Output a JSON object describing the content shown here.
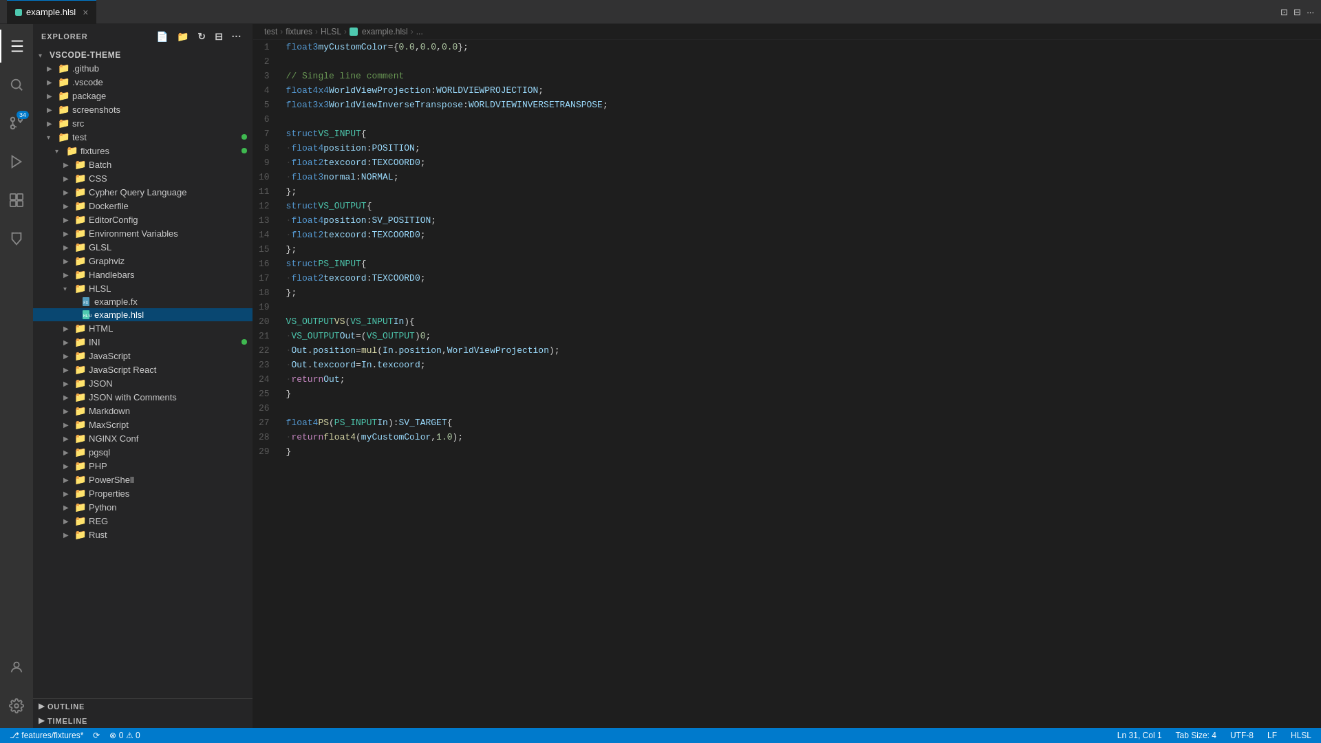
{
  "titlebar": {
    "tab_label": "example.hlsl",
    "tab_icon_color": "#9cdcfe"
  },
  "breadcrumb": {
    "parts": [
      "test",
      "fixtures",
      "HLSL",
      "example.hlsl",
      "..."
    ]
  },
  "explorer": {
    "title": "EXPLORER",
    "root": "VSCODE-THEME",
    "items": [
      {
        "id": "github",
        "label": ".github",
        "type": "folder",
        "indent": 1,
        "collapsed": true
      },
      {
        "id": "vscode",
        "label": ".vscode",
        "type": "folder",
        "indent": 1,
        "collapsed": true
      },
      {
        "id": "package",
        "label": "package",
        "type": "folder",
        "indent": 1,
        "collapsed": true
      },
      {
        "id": "screenshots",
        "label": "screenshots",
        "type": "folder",
        "indent": 1,
        "collapsed": true
      },
      {
        "id": "src",
        "label": "src",
        "type": "folder",
        "indent": 1,
        "collapsed": true
      },
      {
        "id": "test",
        "label": "test",
        "type": "folder",
        "indent": 1,
        "collapsed": false,
        "badge": true
      },
      {
        "id": "fixtures",
        "label": "fixtures",
        "type": "folder",
        "indent": 2,
        "collapsed": false,
        "badge": true
      },
      {
        "id": "batch",
        "label": "Batch",
        "type": "folder",
        "indent": 3,
        "collapsed": true
      },
      {
        "id": "css",
        "label": "CSS",
        "type": "folder",
        "indent": 3,
        "collapsed": true
      },
      {
        "id": "cypher",
        "label": "Cypher Query Language",
        "type": "folder",
        "indent": 3,
        "collapsed": true
      },
      {
        "id": "dockerfile",
        "label": "Dockerfile",
        "type": "folder",
        "indent": 3,
        "collapsed": true
      },
      {
        "id": "editorconfig",
        "label": "EditorConfig",
        "type": "folder",
        "indent": 3,
        "collapsed": true
      },
      {
        "id": "envvars",
        "label": "Environment Variables",
        "type": "folder",
        "indent": 3,
        "collapsed": true
      },
      {
        "id": "glsl",
        "label": "GLSL",
        "type": "folder",
        "indent": 3,
        "collapsed": true
      },
      {
        "id": "graphviz",
        "label": "Graphviz",
        "type": "folder",
        "indent": 3,
        "collapsed": true
      },
      {
        "id": "handlebars",
        "label": "Handlebars",
        "type": "folder",
        "indent": 3,
        "collapsed": true
      },
      {
        "id": "hlsl",
        "label": "HLSL",
        "type": "folder",
        "indent": 3,
        "collapsed": false
      },
      {
        "id": "example-fx",
        "label": "example.fx",
        "type": "file",
        "indent": 4,
        "ext": "fx"
      },
      {
        "id": "example-hlsl",
        "label": "example.hlsl",
        "type": "file",
        "indent": 4,
        "ext": "hlsl",
        "selected": true
      },
      {
        "id": "html",
        "label": "HTML",
        "type": "folder",
        "indent": 3,
        "collapsed": true
      },
      {
        "id": "ini",
        "label": "INI",
        "type": "folder",
        "indent": 3,
        "collapsed": true,
        "badge": true
      },
      {
        "id": "javascript",
        "label": "JavaScript",
        "type": "folder",
        "indent": 3,
        "collapsed": true
      },
      {
        "id": "javascriptreact",
        "label": "JavaScript React",
        "type": "folder",
        "indent": 3,
        "collapsed": true
      },
      {
        "id": "json",
        "label": "JSON",
        "type": "folder",
        "indent": 3,
        "collapsed": true
      },
      {
        "id": "jsoncomments",
        "label": "JSON with Comments",
        "type": "folder",
        "indent": 3,
        "collapsed": true
      },
      {
        "id": "markdown",
        "label": "Markdown",
        "type": "folder",
        "indent": 3,
        "collapsed": true
      },
      {
        "id": "maxscript",
        "label": "MaxScript",
        "type": "folder",
        "indent": 3,
        "collapsed": true
      },
      {
        "id": "nginx",
        "label": "NGINX Conf",
        "type": "folder",
        "indent": 3,
        "collapsed": true
      },
      {
        "id": "pgsql",
        "label": "pgsql",
        "type": "folder",
        "indent": 3,
        "collapsed": true
      },
      {
        "id": "php",
        "label": "PHP",
        "type": "folder",
        "indent": 3,
        "collapsed": true
      },
      {
        "id": "powershell",
        "label": "PowerShell",
        "type": "folder",
        "indent": 3,
        "collapsed": true
      },
      {
        "id": "properties",
        "label": "Properties",
        "type": "folder",
        "indent": 3,
        "collapsed": true
      },
      {
        "id": "python",
        "label": "Python",
        "type": "folder",
        "indent": 3,
        "collapsed": true
      },
      {
        "id": "reg",
        "label": "REG",
        "type": "folder",
        "indent": 3,
        "collapsed": true
      },
      {
        "id": "rust",
        "label": "Rust",
        "type": "folder",
        "indent": 3,
        "collapsed": true
      }
    ]
  },
  "outline": {
    "label": "OUTLINE"
  },
  "timeline": {
    "label": "TIMELINE"
  },
  "activity": {
    "icons": [
      "explorer",
      "search",
      "source-control",
      "run",
      "extensions",
      "testing",
      "account",
      "settings"
    ],
    "badge": {
      "icon": "source-control",
      "count": "34"
    }
  },
  "statusbar": {
    "branch": "features/fixtures*",
    "sync_icon": true,
    "errors": "0",
    "warnings": "0",
    "position": "Ln 31, Col 1",
    "tab_size": "Tab Size: 4",
    "encoding": "UTF-8",
    "line_ending": "LF",
    "language": "HLSL"
  },
  "code": {
    "lines": [
      {
        "num": 1,
        "html": "<span class='kw'>float3</span> <span class='var'>myCustomColor</span> <span class='op'>=</span> <span class='punc'>{</span><span class='num'>0.0</span><span class='punc'>,</span> <span class='num'>0.0</span><span class='punc'>,</span> <span class='num'>0.0</span><span class='punc'>};</span>"
      },
      {
        "num": 2,
        "html": ""
      },
      {
        "num": 3,
        "html": "<span class='comment'>// Single line comment</span>"
      },
      {
        "num": 4,
        "html": "<span class='kw'>float4x4</span> <span class='var'>WorldViewProjection</span><span class='punc'>:</span> <span class='semantic'>WORLDVIEWPROJECTION</span><span class='punc'>;</span>"
      },
      {
        "num": 5,
        "html": "<span class='kw'>float3x3</span> <span class='var'>WorldViewInverseTranspose</span><span class='punc'>:</span> <span class='semantic'>WORLDVIEWINVERSETRANSPOSE</span><span class='punc'>;</span>"
      },
      {
        "num": 6,
        "html": ""
      },
      {
        "num": 7,
        "html": "<span class='kw'>struct</span> <span class='type'>VS_INPUT</span> <span class='punc'>{</span>"
      },
      {
        "num": 8,
        "html": "    <span class='kw'>float4</span> <span class='var'>position</span><span class='punc'>:</span> <span class='semantic'>POSITION</span><span class='punc'>;</span>",
        "arrow": true
      },
      {
        "num": 9,
        "html": "    <span class='kw'>float2</span> <span class='var'>texcoord</span><span class='punc'>:</span> <span class='semantic'>TEXCOORD0</span><span class='punc'>;</span>",
        "arrow": true
      },
      {
        "num": 10,
        "html": "    <span class='kw'>float3</span> <span class='var'>normal</span><span class='punc'>:</span> <span class='semantic'>NORMAL</span><span class='punc'>;</span>",
        "arrow": true
      },
      {
        "num": 11,
        "html": "<span class='punc'>};</span>"
      },
      {
        "num": 12,
        "html": "<span class='kw'>struct</span> <span class='type'>VS_OUTPUT</span> <span class='punc'>{</span>"
      },
      {
        "num": 13,
        "html": "    <span class='kw'>float4</span> <span class='var'>position</span><span class='punc'>:</span> <span class='semantic'>SV_POSITION</span><span class='punc'>;</span>",
        "arrow": true
      },
      {
        "num": 14,
        "html": "    <span class='kw'>float2</span> <span class='var'>texcoord</span><span class='punc'>:</span> <span class='semantic'>TEXCOORD0</span><span class='punc'>;</span>",
        "arrow": true
      },
      {
        "num": 15,
        "html": "<span class='punc'>};</span>"
      },
      {
        "num": 16,
        "html": "<span class='kw'>struct</span> <span class='type'>PS_INPUT</span> <span class='punc'>{</span>"
      },
      {
        "num": 17,
        "html": "    <span class='kw'>float2</span> <span class='var'>texcoord</span><span class='punc'>:</span> <span class='semantic'>TEXCOORD0</span><span class='punc'>;</span>",
        "arrow": true
      },
      {
        "num": 18,
        "html": "<span class='punc'>};</span>"
      },
      {
        "num": 19,
        "html": ""
      },
      {
        "num": 20,
        "html": "<span class='type'>VS_OUTPUT</span> <span class='fn'>VS</span><span class='punc'>(</span><span class='type'>VS_INPUT</span> <span class='var'>In</span><span class='punc'>){</span>"
      },
      {
        "num": 21,
        "html": "    <span class='type'>VS_OUTPUT</span> <span class='var'>Out</span> <span class='op'>=</span> <span class='punc'>(</span><span class='type'>VS_OUTPUT</span><span class='punc'>)</span><span class='num'>0</span><span class='punc'>;</span>",
        "arrow": true
      },
      {
        "num": 22,
        "html": "    <span class='var'>Out</span><span class='punc'>.</span><span class='var'>position</span> <span class='op'>=</span> <span class='fn'>mul</span><span class='punc'>(</span><span class='var'>In</span><span class='punc'>.</span><span class='var'>position</span><span class='punc'>,</span> <span class='var'>WorldViewProjection</span><span class='punc'>);</span>",
        "arrow": true
      },
      {
        "num": 23,
        "html": "    <span class='var'>Out</span><span class='punc'>.</span><span class='var'>texcoord</span> <span class='op'>=</span> <span class='var'>In</span><span class='punc'>.</span><span class='var'>texcoord</span><span class='punc'>;</span>",
        "arrow": true
      },
      {
        "num": 24,
        "html": "    <span class='kw2'>return</span> <span class='var'>Out</span><span class='punc'>;</span>",
        "arrow": true
      },
      {
        "num": 25,
        "html": "<span class='punc'>}</span>"
      },
      {
        "num": 26,
        "html": ""
      },
      {
        "num": 27,
        "html": "<span class='kw'>float4</span> <span class='fn'>PS</span><span class='punc'>(</span><span class='type'>PS_INPUT</span> <span class='var'>In</span><span class='punc'>):</span> <span class='semantic'>SV_TARGET</span> <span class='punc'>{</span>"
      },
      {
        "num": 28,
        "html": "    <span class='kw2'>return</span> <span class='fn'>float4</span><span class='punc'>(</span><span class='var'>myCustomColor</span><span class='punc'>,</span> <span class='num'>1.0</span><span class='punc'>);</span>",
        "arrow": true
      },
      {
        "num": 29,
        "html": "<span class='punc'>}</span>"
      }
    ]
  }
}
